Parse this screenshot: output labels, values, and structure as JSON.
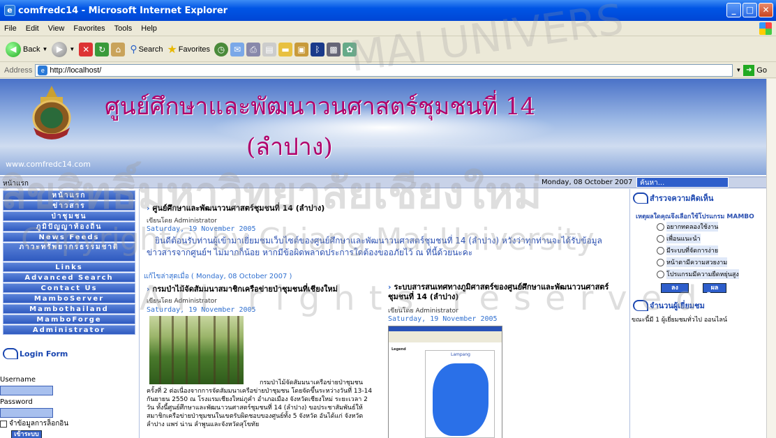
{
  "window": {
    "title": "comfredc14 - Microsoft Internet Explorer",
    "min": "_",
    "max": "□",
    "close": "✕"
  },
  "menu": [
    "File",
    "Edit",
    "View",
    "Favorites",
    "Tools",
    "Help"
  ],
  "toolbar": {
    "back": "Back",
    "search": "Search",
    "favorites": "Favorites"
  },
  "address": {
    "label": "Address",
    "url": "http://localhost/",
    "go": "Go"
  },
  "banner": {
    "title_line1": "ศูนย์ศึกษาและพัฒนาวนศาสตร์ชุมชนที่ 14",
    "title_line2": "(ลำปาง)",
    "url": "www.comfredc14.com"
  },
  "navstrip": {
    "home": "หน้าแรก",
    "date": "Monday, 08 October 2007",
    "search_placeholder": "ค้นหา..."
  },
  "left_menu": [
    "หน้าแรก",
    "ข่าวสาร",
    "ป่าชุมชน",
    "ภูมิปัญญาท้องถิ่น",
    "News Feeds",
    "ภาวะทรัพยากรธรรมชาติ",
    "Links",
    "Advanced Search",
    "Contact Us",
    "MamboServer",
    "Mambothailand",
    "MamboForge",
    "Administrator"
  ],
  "login": {
    "header": "Login Form",
    "username_label": "Username",
    "password_label": "Password",
    "remember": "จำข้อมูลการล็อกอิน",
    "button": "เข้าระบบ"
  },
  "main_article": {
    "title": "ศูนย์ศึกษาและพัฒนาวนศาสตร์ชุมชนที่ 14 (ลำปาง)",
    "author": "เขียนโดย Administrator",
    "date": "Saturday, 19 November 2005",
    "body": "ยินดีต้อนรับท่านผู้เข้ามาเยี่ยมชมเว็บไซต์ของศูนย์ศึกษาและพัฒนาวนศาสตร์ชุมชนที่ 14 (ลำปาง) หวังว่าทุกท่านจะได้รับข้อมูลข่าวสารจากศูนย์ฯ ไม่มากก็น้อย หากมีข้อผิดพลาดประการใดต้องขออภัยไว้ ณ ที่นี้ด้วยนะคะ",
    "updated": "แก้ไขล่าสุดเมื่อ ( Monday, 08 October 2007 )"
  },
  "article2": {
    "title": "กรมป่าไม้จัดสัมมนาสมาชิกเครือข่ายป่าชุมชนที่เชียงใหม่",
    "author": "เขียนโดย Administrator",
    "date": "Saturday, 19 November 2005",
    "caption": "กรมป่าไม้จัดสัมมนาเครือข่ายป่าชุมชน",
    "body": "ครั้งที่ 2 ต่อเนื่องจากการจัดสัมมนาเครือข่ายป่าชุมชน โดยจัดขึ้นระหว่างวันที่ 13-14 กันยายน 2550 ณ โรงแรมเชียงใหม่ภูคำ อำเภอเมือง จังหวัดเชียงใหม่ ระยะเวลา 2 วัน ทั้งนี้ศูนย์ศึกษาและพัฒนาวนศาสตร์ชุมชนที่ 14 (ลำปาง) ขอประชาสัมพันธ์ให้สมาชิกเครือข่ายป่าชุมชนในเขตรับผิดชอบของศูนย์ทั้ง 5 จังหวัด อันได้แก่ จังหวัดลำปาง แพร่ น่าน ลำพูนและจังหวัดสุโขทัย"
  },
  "article3": {
    "title": "ระบบสารสนเทศทางภูมิศาสตร์ของศูนย์ศึกษาและพัฒนาวนศาสตร์ชุมชนที่ 14 (ลำปาง)",
    "author": "เขียนโดย Administrator",
    "date": "Saturday, 19 November 2005",
    "map_legend": "Legend",
    "map_title": "Lampang"
  },
  "poll": {
    "header": "สำรวจความคิดเห็น",
    "question": "เหตุผลใดคุณจึงเลือกใช้โปรแกรม MAMBO",
    "options": [
      "อยากทดลองใช้งาน",
      "เพื่อนแนะนำ",
      "มีระบบที่จัดการง่าย",
      "หน้าตามีความสวยงาม",
      "โปรแกรมมีความยืดหยุ่นสูง"
    ],
    "vote": "ลงคะแนน",
    "results": "ผลโหวต"
  },
  "visitors": {
    "header": "จำนวนผู้เยี่ยมชม",
    "text": "ขณะนี้มี 1 ผู้เยี่ยมชมทั่วไป ออนไลน์"
  },
  "watermark": {
    "line1": "MAI UNIVERS",
    "line2": "ลิขสิทธิ์มหาวิทยาลัยเชียงใหม่",
    "line3": "Copyright© by Chiang Mai University",
    "line4": "All rights reserved"
  },
  "colors": {
    "menu_blue": "#2f5ac0",
    "banner_title": "#b0006a",
    "link_blue": "#3070d0"
  }
}
